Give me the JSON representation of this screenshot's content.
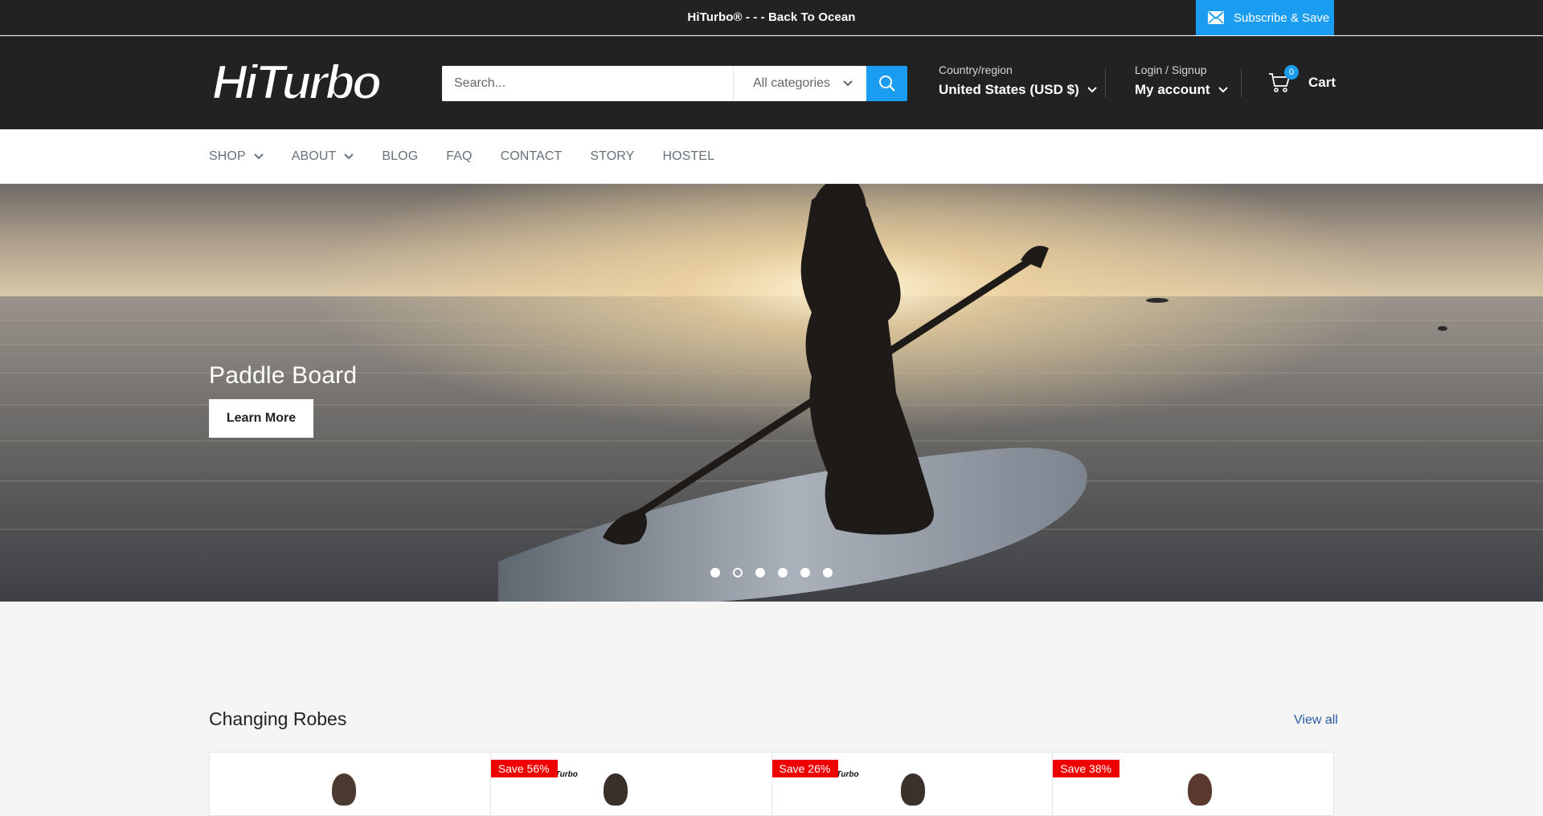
{
  "announcement": {
    "text": "HiTurbo® - - - Back To Ocean",
    "subscribe_label": "Subscribe & Save"
  },
  "header": {
    "logo_text": "HiTurbo",
    "search": {
      "placeholder": "Search...",
      "category_label": "All categories"
    },
    "region": {
      "label": "Country/region",
      "value": "United States (USD $)"
    },
    "account": {
      "login_label": "Login / Signup",
      "account_label": "My account"
    },
    "cart": {
      "count": "0",
      "label": "Cart"
    }
  },
  "nav": {
    "items": [
      {
        "label": "SHOP",
        "has_dropdown": true
      },
      {
        "label": "ABOUT",
        "has_dropdown": true
      },
      {
        "label": "BLOG",
        "has_dropdown": false
      },
      {
        "label": "FAQ",
        "has_dropdown": false
      },
      {
        "label": "CONTACT",
        "has_dropdown": false
      },
      {
        "label": "STORY",
        "has_dropdown": false
      },
      {
        "label": "HOSTEL",
        "has_dropdown": false
      }
    ]
  },
  "hero": {
    "title": "Paddle Board",
    "button_label": "Learn More",
    "slide_count": 6,
    "active_slide": 2
  },
  "collection": {
    "title": "Changing Robes",
    "view_all_label": "View all",
    "cards": [
      {
        "badge": "",
        "logo": ""
      },
      {
        "badge": "Save 56%",
        "logo": "HiTurbo"
      },
      {
        "badge": "Save 26%",
        "logo": "HiTurbo"
      },
      {
        "badge": "Save 38%",
        "logo": ""
      }
    ]
  },
  "colors": {
    "header_bg": "#222222",
    "accent": "#1a9cf0",
    "badge": "#e00000",
    "link": "#2a5aa0"
  }
}
